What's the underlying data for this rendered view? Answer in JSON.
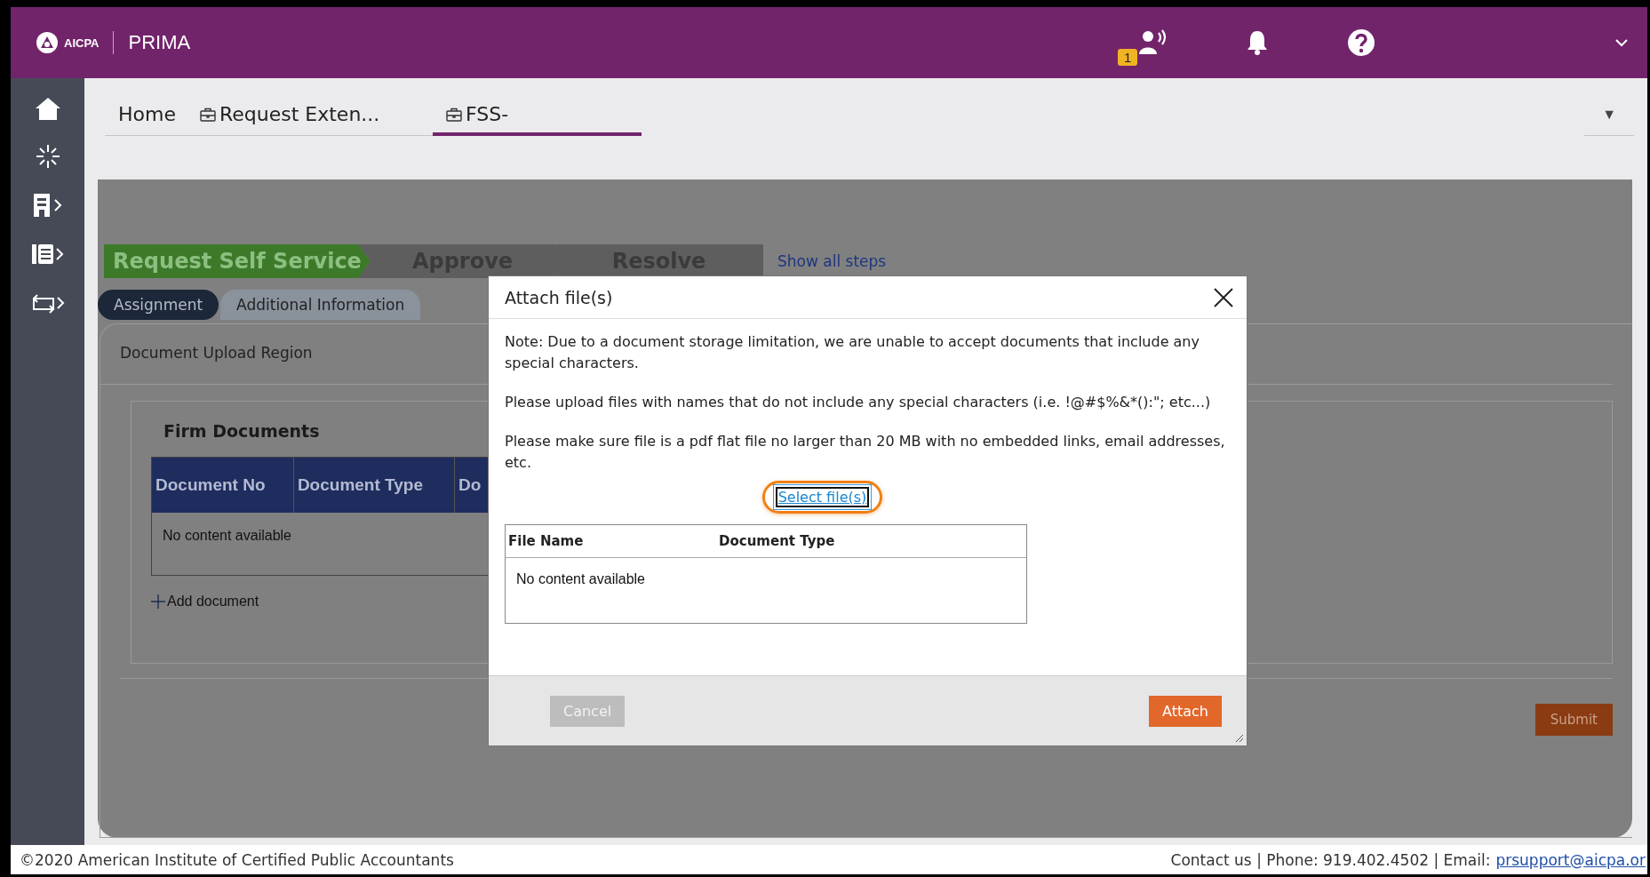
{
  "header": {
    "logo_small": "AICPA",
    "product": "PRIMA",
    "notification_badge": "1"
  },
  "tabs": [
    {
      "label": "Home",
      "icon": false,
      "selected": false
    },
    {
      "label": "Request Exten...",
      "icon": true,
      "selected": false
    },
    {
      "label": "FSS-",
      "icon": true,
      "selected": true
    }
  ],
  "tab_menu": "▼",
  "steps": [
    {
      "label": "Request Self Service",
      "current": true
    },
    {
      "label": "Approve",
      "current": false
    },
    {
      "label": "Resolve",
      "current": false
    }
  ],
  "show_all_steps": "Show all steps",
  "subtabs": [
    {
      "label": "Assignment",
      "selected": true
    },
    {
      "label": "Additional Information",
      "selected": false
    }
  ],
  "region_title": "Document Upload Region",
  "section_title": "Firm Documents",
  "table": {
    "columns": [
      "Document No",
      "Document Type",
      "Do"
    ],
    "empty": "No content available"
  },
  "add_document": "Add document",
  "submit": "Submit",
  "dialog": {
    "title": "Attach file(s)",
    "paragraphs": [
      "Note: Due to a document storage limitation, we are unable to accept documents that include any special characters.",
      "Please upload files with names that do not include any special characters (i.e. !@#$%&*():\"; etc...)",
      "Please make sure file is a pdf flat file no larger than 20 MB with no embedded links, email addresses, etc."
    ],
    "select_link": "Select file(s)",
    "highlighted": true,
    "columns": [
      "File Name",
      "Document Type"
    ],
    "empty": "No content available",
    "buttons": [
      {
        "label": "Cancel",
        "kind": "secondary",
        "disabled": true
      },
      {
        "label": "Attach",
        "kind": "primary",
        "disabled": false
      }
    ]
  },
  "footer": {
    "copyright": "©2020 American Institute of Certified Public Accountants",
    "contact": "Contact us | Phone: 919.402.4502 | Email:",
    "email": "prsupport@aicpa.or"
  }
}
